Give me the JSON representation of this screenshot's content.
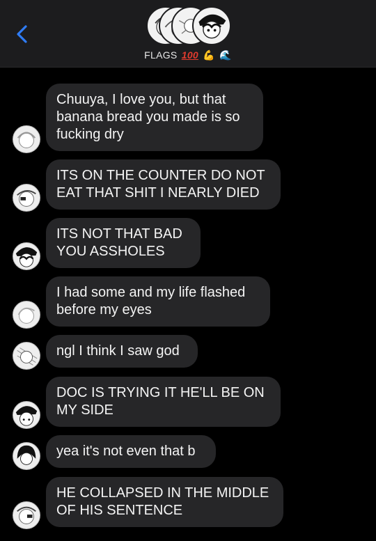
{
  "header": {
    "group_name": "FLAGS",
    "emojis": [
      "100",
      "💪",
      "🌊"
    ],
    "back_icon": "chevron-left-icon"
  },
  "messages": [
    {
      "text": "Chuuya, I love you, but that\nbanana bread you made is so\nfucking dry",
      "avatar": "avatar-light-hair"
    },
    {
      "text": "ITS ON THE COUNTER DO NOT\nEAT THAT SHIT I NEARLY DIED",
      "avatar": "avatar-eyepatch"
    },
    {
      "text": "ITS NOT THAT BAD\nYOU ASSHOLES",
      "avatar": "avatar-hat"
    },
    {
      "text": "I had some and my life flashed\nbefore my eyes",
      "avatar": "avatar-light-hair-2"
    },
    {
      "text": "ngl I think I saw god",
      "avatar": "avatar-hatched"
    },
    {
      "text": "DOC IS TRYING IT HE'LL BE ON\nMY SIDE",
      "avatar": "avatar-hat-2"
    },
    {
      "text": "yea it's not even that b",
      "avatar": "avatar-dark-hair"
    },
    {
      "text": "HE COLLAPSED IN THE MIDDLE\nOF HIS SENTENCE",
      "avatar": "avatar-eyepatch-2"
    }
  ],
  "colors": {
    "header_bg": "#1c1c1e",
    "bubble_bg": "#262628",
    "accent": "#2f7cf6"
  }
}
